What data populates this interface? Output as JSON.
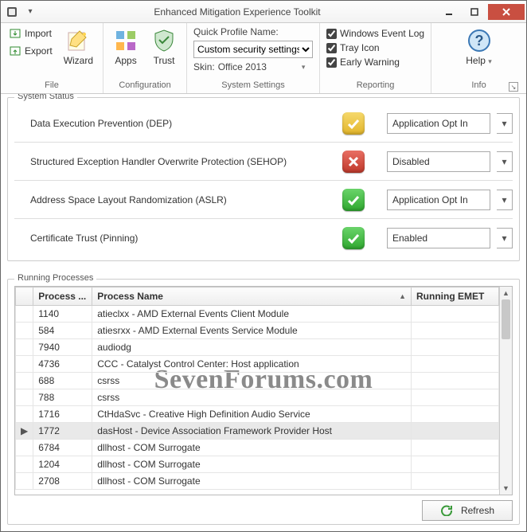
{
  "window": {
    "title": "Enhanced Mitigation Experience Toolkit"
  },
  "ribbon": {
    "file": {
      "groupLabel": "File",
      "import": "Import",
      "export": "Export",
      "wizard": "Wizard"
    },
    "config": {
      "groupLabel": "Configuration",
      "apps": "Apps",
      "trust": "Trust"
    },
    "settings": {
      "groupLabel": "System Settings",
      "quickProfileLabel": "Quick Profile Name:",
      "quickProfileValue": "Custom security settings",
      "skinLabel": "Skin:",
      "skinValue": "Office 2013"
    },
    "reporting": {
      "groupLabel": "Reporting",
      "eventLog": "Windows Event Log",
      "trayIcon": "Tray Icon",
      "earlyWarning": "Early Warning"
    },
    "info": {
      "groupLabel": "Info",
      "help": "Help"
    }
  },
  "systemStatus": {
    "legend": "System Status",
    "rows": [
      {
        "label": "Data Execution Prevention (DEP)",
        "state": "amber",
        "mark": "check",
        "value": "Application Opt In"
      },
      {
        "label": "Structured Exception Handler Overwrite Protection (SEHOP)",
        "state": "red",
        "mark": "cross",
        "value": "Disabled"
      },
      {
        "label": "Address Space Layout Randomization (ASLR)",
        "state": "green",
        "mark": "check",
        "value": "Application Opt In"
      },
      {
        "label": "Certificate Trust (Pinning)",
        "state": "green",
        "mark": "check",
        "value": "Enabled"
      }
    ]
  },
  "watermark": "SevenForums.com",
  "processes": {
    "legend": "Running Processes",
    "cols": {
      "pid": "Process ...",
      "name": "Process Name",
      "emet": "Running EMET"
    },
    "selectedPid": "1772",
    "rows": [
      {
        "pid": "1140",
        "name": "atieclxx - AMD External Events Client Module"
      },
      {
        "pid": "584",
        "name": "atiesrxx - AMD External Events Service Module"
      },
      {
        "pid": "7940",
        "name": "audiodg"
      },
      {
        "pid": "4736",
        "name": "CCC - Catalyst Control Center: Host application"
      },
      {
        "pid": "688",
        "name": "csrss"
      },
      {
        "pid": "788",
        "name": "csrss"
      },
      {
        "pid": "1716",
        "name": "CtHdaSvc - Creative High Definition Audio Service"
      },
      {
        "pid": "1772",
        "name": "dasHost - Device Association Framework Provider Host"
      },
      {
        "pid": "6784",
        "name": "dllhost - COM Surrogate"
      },
      {
        "pid": "1204",
        "name": "dllhost - COM Surrogate"
      },
      {
        "pid": "2708",
        "name": "dllhost - COM Surrogate"
      }
    ],
    "refresh": "Refresh"
  }
}
